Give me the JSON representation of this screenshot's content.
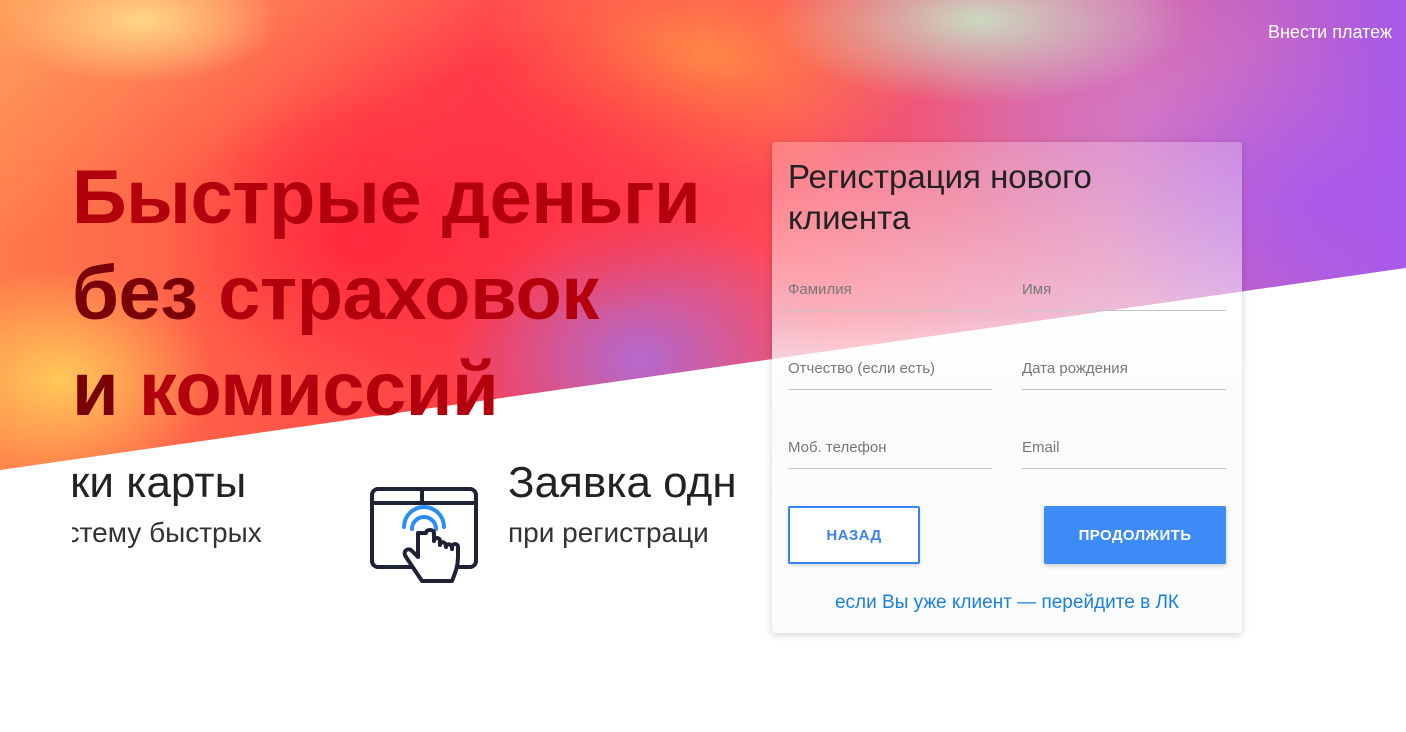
{
  "header": {
    "payment_link": "Внести платеж"
  },
  "hero": {
    "line1": "Быстрые деньги",
    "line2a": "без",
    "line2b": "страховок",
    "line3a": "и ",
    "line3b": "комиссий"
  },
  "features": [
    {
      "title": "зки карты",
      "description": "истему быстрых"
    },
    {
      "title": "Заявка одн",
      "description": "при регистраци",
      "icon": "touch-screen-icon"
    }
  ],
  "registration": {
    "title": "Регистрация нового клиента",
    "fields": {
      "last_name": "Фамилия",
      "first_name": "Имя",
      "patronymic": "Отчество (если есть)",
      "birth_date": "Дата рождения",
      "phone": "Моб. телефон",
      "email": "Email"
    },
    "back_label": "НАЗАД",
    "continue_label": "ПРОДОЛЖИТЬ",
    "login_link": "если Вы уже клиент — перейдите в ЛК"
  },
  "colors": {
    "accent": "#3d8bf7",
    "link": "#1a7ee0",
    "headline": "#b2000c"
  }
}
